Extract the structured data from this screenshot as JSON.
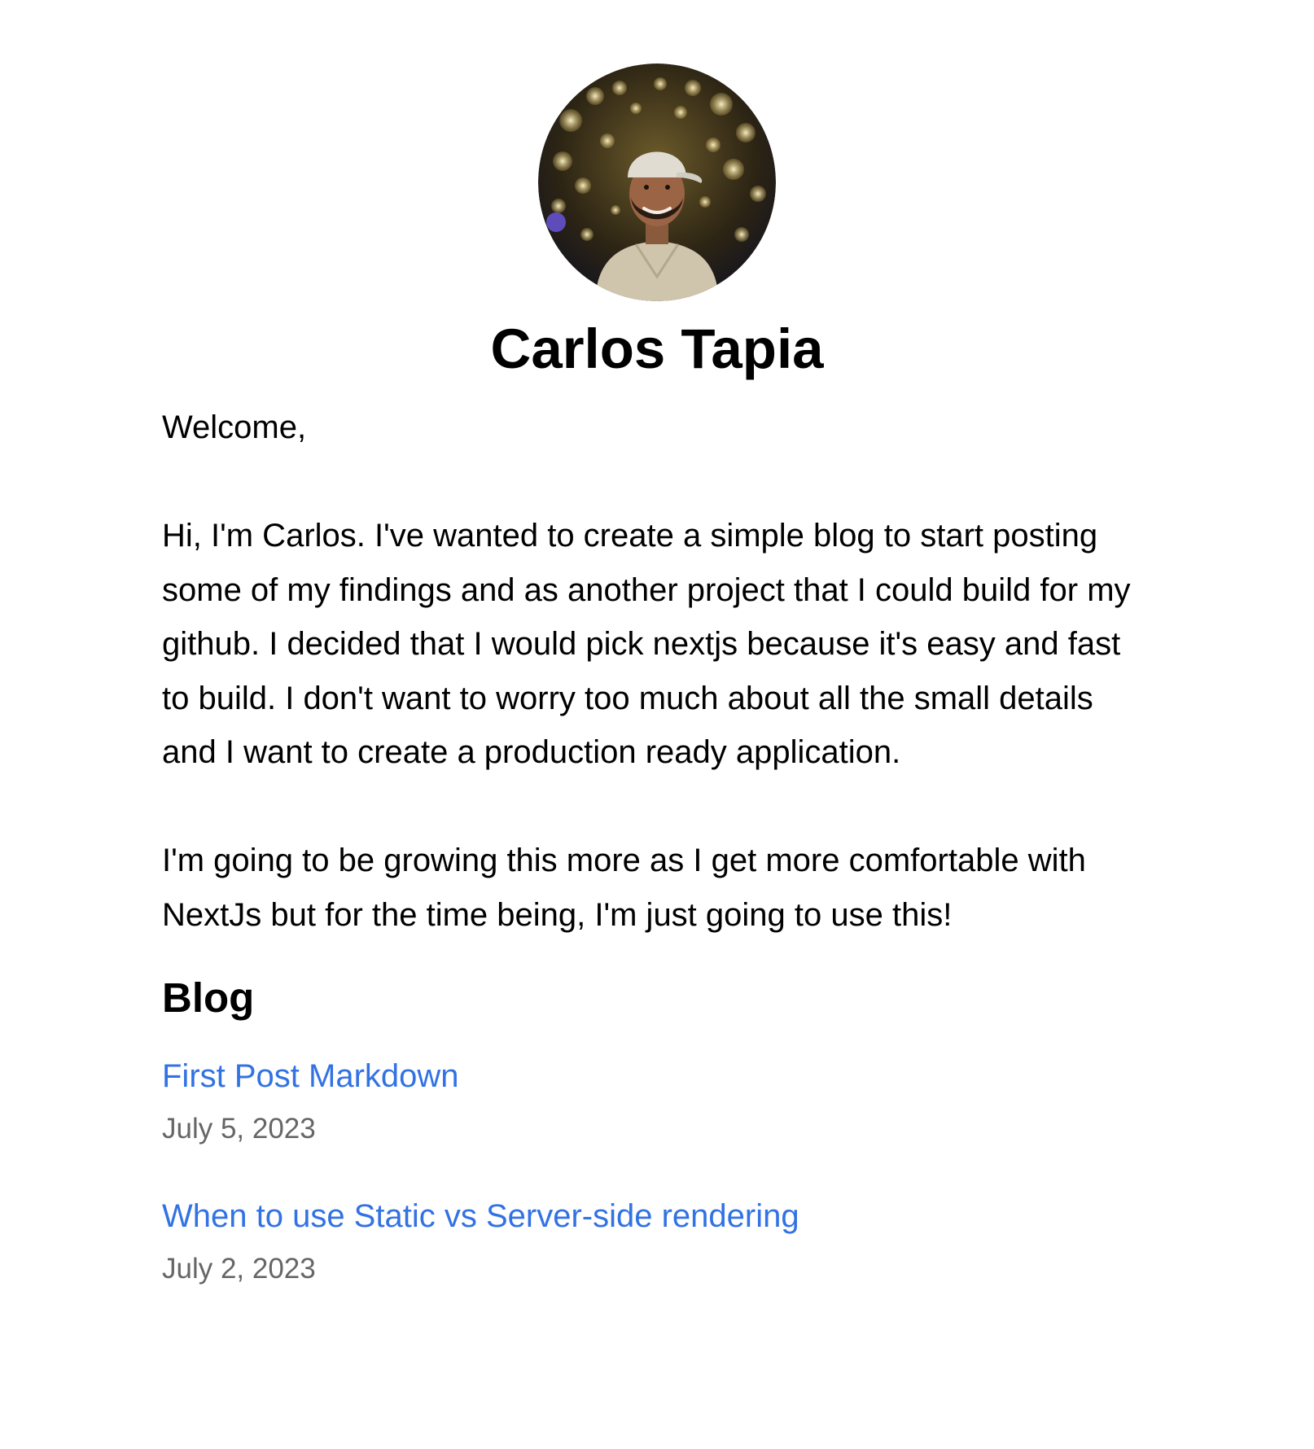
{
  "profile": {
    "name": "Carlos Tapia",
    "avatar_alt": "avatar"
  },
  "intro": {
    "greeting": "Welcome,",
    "paragraph1": "Hi, I'm Carlos. I've wanted to create a simple blog to start posting some of my findings and as another project that I could build for my github. I decided that I would pick nextjs because it's easy and fast to build. I don't want to worry too much about all the small details and I want to create a production ready application.",
    "paragraph2": "I'm going to be growing this more as I get more comfortable with NextJs but for the time being, I'm just going to use this!"
  },
  "blog": {
    "heading": "Blog",
    "posts": [
      {
        "title": "First Post Markdown",
        "date": "July 5, 2023"
      },
      {
        "title": "When to use Static vs Server-side rendering",
        "date": "July 2, 2023"
      }
    ]
  },
  "colors": {
    "link": "#3272e3",
    "date": "#666666",
    "text": "#000000"
  }
}
